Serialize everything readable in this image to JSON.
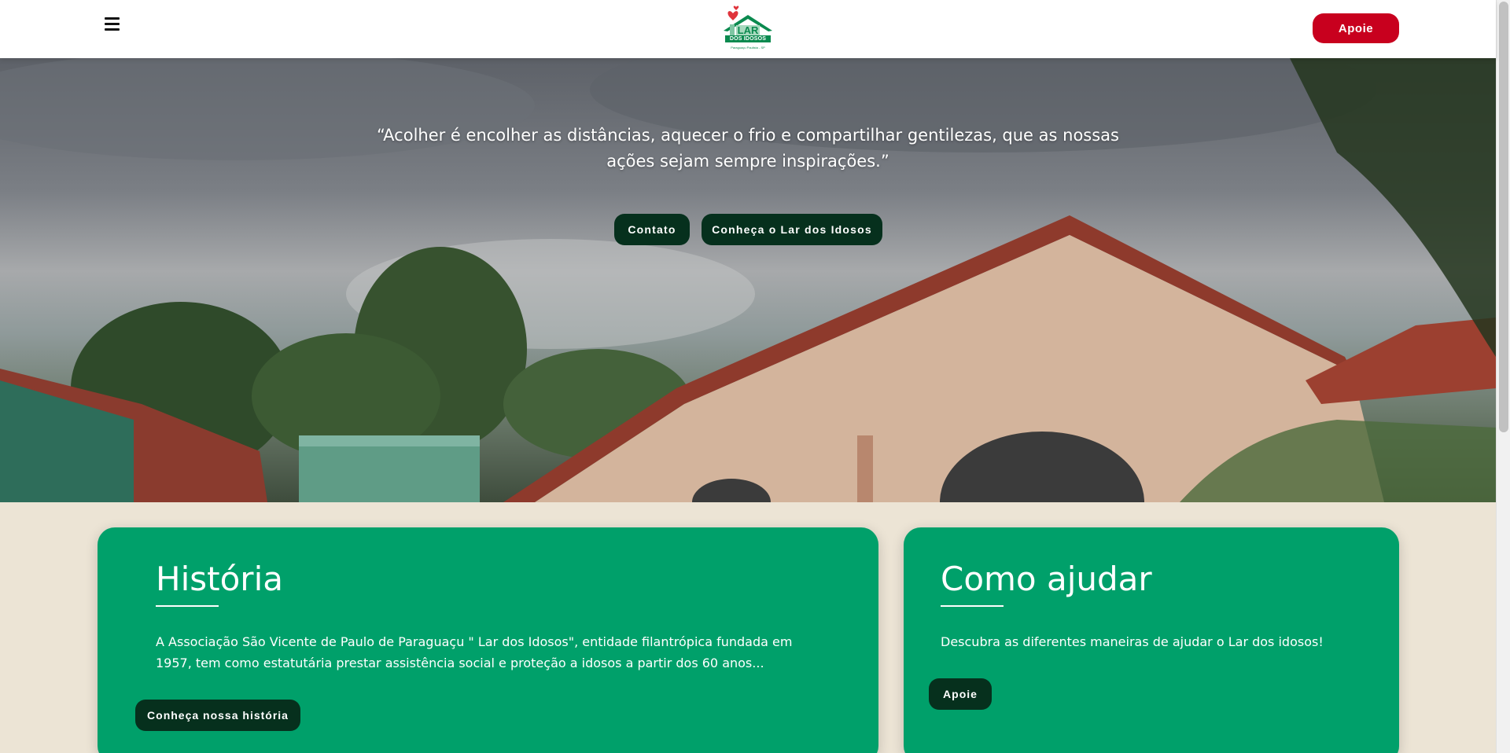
{
  "header": {
    "logo_text": "DOS IDOSOS",
    "logo_subtext": "Paraguaçu Paulista - SP",
    "apoie_label": "Apoie"
  },
  "hero": {
    "quote": "“Acolher é encolher as distâncias, aquecer o frio e compartilhar gentilezas, que as nossas ações sejam sempre inspirações.”",
    "contato_label": "Contato",
    "conheca_label": "Conheça o Lar dos Idosos"
  },
  "cards": {
    "historia": {
      "title": "História",
      "text": "A Associação São Vicente de Paulo de Paraguaçu \" Lar dos Idosos\", entidade filantrópica fundada em 1957, tem como estatutária prestar assistência social e proteção a idosos a partir dos 60 anos...",
      "button_label": "Conheça nossa história"
    },
    "ajudar": {
      "title": "Como ajudar",
      "text": "Descubra as diferentes maneiras de ajudar o Lar dos idosos!",
      "button_label": "Apoie"
    }
  },
  "colors": {
    "brand_green": "#00a06a",
    "dark_green_button": "#06301d",
    "apoie_red": "#c8001e",
    "page_background": "#ece4d5"
  },
  "icons": {
    "menu": "hamburger-menu-icon",
    "logo": "house-heart-logo"
  }
}
